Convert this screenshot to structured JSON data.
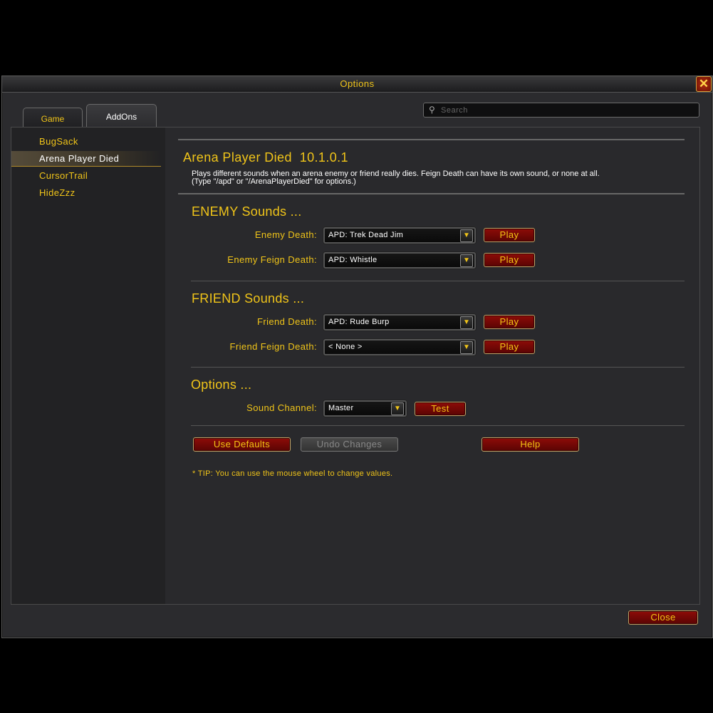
{
  "window": {
    "title": "Options"
  },
  "tabs": [
    {
      "label": "Game"
    },
    {
      "label": "AddOns"
    }
  ],
  "search": {
    "placeholder": "Search"
  },
  "sidebar": {
    "items": [
      {
        "label": "BugSack"
      },
      {
        "label": "Arena Player Died"
      },
      {
        "label": "CursorTrail"
      },
      {
        "label": "HideZzz"
      }
    ],
    "selected": "Arena Player Died"
  },
  "addon": {
    "name": "Arena Player Died",
    "version": "10.1.0.1",
    "description_line1": "Plays different sounds when an arena enemy or friend really dies.  Feign Death can have its own sound, or none at all.",
    "description_line2": "(Type \"/apd\" or \"/ArenaPlayerDied\" for options.)"
  },
  "enemy": {
    "heading": "ENEMY Sounds ...",
    "death_label": "Enemy Death:",
    "death_value": "APD: Trek Dead Jim",
    "feign_label": "Enemy Feign Death:",
    "feign_value": "APD: Whistle"
  },
  "friend": {
    "heading": "FRIEND Sounds ...",
    "death_label": "Friend Death:",
    "death_value": "APD: Rude Burp",
    "feign_label": "Friend Feign Death:",
    "feign_value": "< None >"
  },
  "options": {
    "heading": "Options ...",
    "channel_label": "Sound Channel:",
    "channel_value": "Master",
    "test_label": "Test"
  },
  "buttons": {
    "play": "Play",
    "use_defaults": "Use Defaults",
    "undo_changes": "Undo Changes",
    "help": "Help",
    "close": "Close"
  },
  "tip": "* TIP: You can use the mouse wheel to change values.",
  "icons": {
    "close": "close-x-icon",
    "search": "search-icon",
    "dropdown": "chevron-down-icon"
  },
  "colors": {
    "gold": "#f0c419",
    "button_red": "#8e0c08",
    "panel": "#29292c"
  }
}
